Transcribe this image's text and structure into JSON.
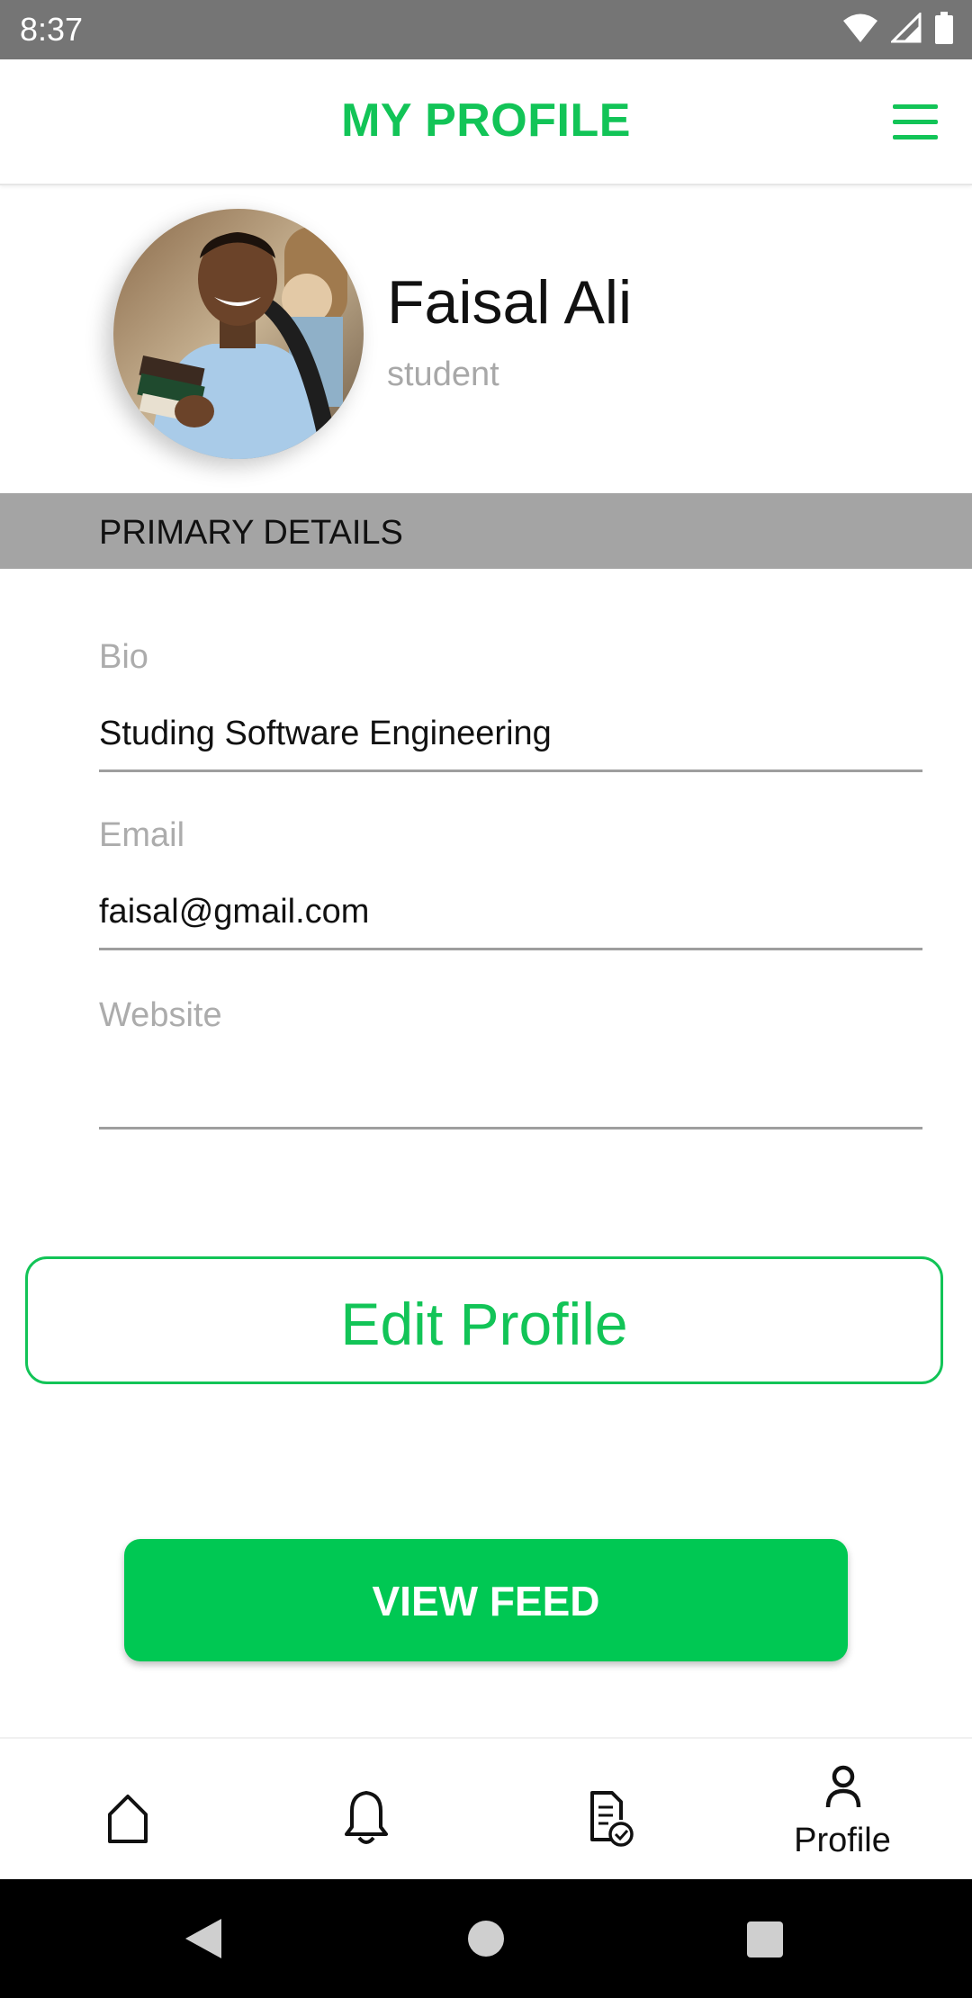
{
  "status_bar": {
    "time": "8:37",
    "icons": [
      "wifi-icon",
      "signal-icon",
      "battery-icon"
    ]
  },
  "header": {
    "title": "MY PROFILE",
    "menu_icon": "hamburger-menu-icon"
  },
  "profile": {
    "name": "Faisal Ali",
    "role": "student",
    "avatar": "profile-photo"
  },
  "section": {
    "title": "PRIMARY DETAILS"
  },
  "fields": [
    {
      "label": "Bio",
      "value": "Studing Software Engineering"
    },
    {
      "label": "Email",
      "value": "faisal@gmail.com"
    },
    {
      "label": "Website",
      "value": ""
    }
  ],
  "buttons": {
    "edit_profile": "Edit Profile",
    "view_feed": "VIEW FEED"
  },
  "bottom_nav": {
    "items": [
      {
        "icon": "home-icon",
        "label": ""
      },
      {
        "icon": "bell-icon",
        "label": ""
      },
      {
        "icon": "document-check-icon",
        "label": ""
      },
      {
        "icon": "profile-icon",
        "label": "Profile"
      }
    ]
  },
  "system_nav": {
    "icons": [
      "back-icon",
      "home-circle-icon",
      "recents-icon"
    ]
  },
  "colors": {
    "accent": "#12c457",
    "button_fill": "#00c853",
    "status_bar": "#757575",
    "section_bar": "#a4a4a4"
  }
}
